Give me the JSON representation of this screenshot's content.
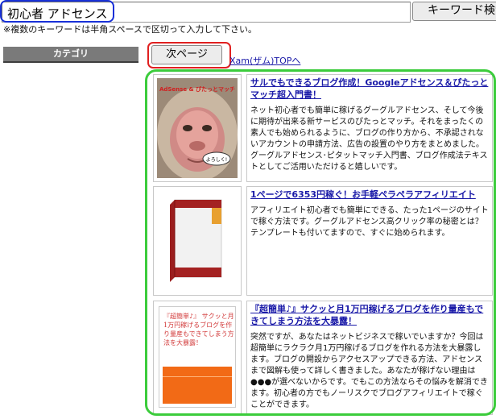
{
  "search": {
    "value": "初心者 アドセンス",
    "button_label": "キーワード検索",
    "hint": "※複数のキーワードは半角スペースで区切って入力して下さい。"
  },
  "sidebar": {
    "category_label": "カテゴリ"
  },
  "pager": {
    "next_label": "次ページ",
    "top_link": "Xam(ザム)TOPへ"
  },
  "products": [
    {
      "title": "サルでもできるブログ作成！Googleアドセンス＆ぴたっとマッチ超入門書！",
      "description": "ネット初心者でも簡単に稼げるグーグルアドセンス、そして今後に期待が出来る新サービスのぴたっとマッチ。それをまったくの素人でも始められるように、ブログの作り方から、不承認されないアカウントの申請方法、広告の設置のやり方をまとめました。グーグルアドセンス･ピタットマッチ入門書、ブログ作成法テキストとしてご活用いただけると嬉しいです。",
      "cover_title": "AdSense & ぴたっとマッチ",
      "cover_speech": "よろしく!"
    },
    {
      "title": "1ページで6353円稼ぐ！お手軽ペラペラアフィリエイト",
      "description": "アフィリエイト初心者でも簡単にできる、たった1ページのサイトで稼ぐ方法です。グーグルアドセンス高クリック率の秘密とは？テンプレートも付いてますので、すぐに始められます。"
    },
    {
      "title": "『超簡単♪』サクッと月1万円稼げるブログを作り量産もできてしまう方法を大暴露！",
      "description": "突然ですが、あなたはネットビジネスで稼いでいますか？今回は超簡単にラクラク月1万円稼げるブログを作れる方法を大暴露します。ブログの開設からアクセスアップできる方法、アドセンスまで図解も使って詳しく書きました。あなたが稼げない理由は ●●●が選べないからです。でもこの方法ならその悩みを解消できます。初心者の方でもノーリスクでブログアフィリエイトで稼ぐことができます。",
      "cover_text": "『超簡単♪』 サクッと月1万円稼げるブログを作り量産もできてしまう方法を大暴露！"
    }
  ],
  "colors": {
    "link": "#1a1aa8",
    "highlight_blue": "#1830d8",
    "highlight_red": "#e02020",
    "highlight_green": "#3ccc3c",
    "cover_orange": "#f26a16"
  }
}
